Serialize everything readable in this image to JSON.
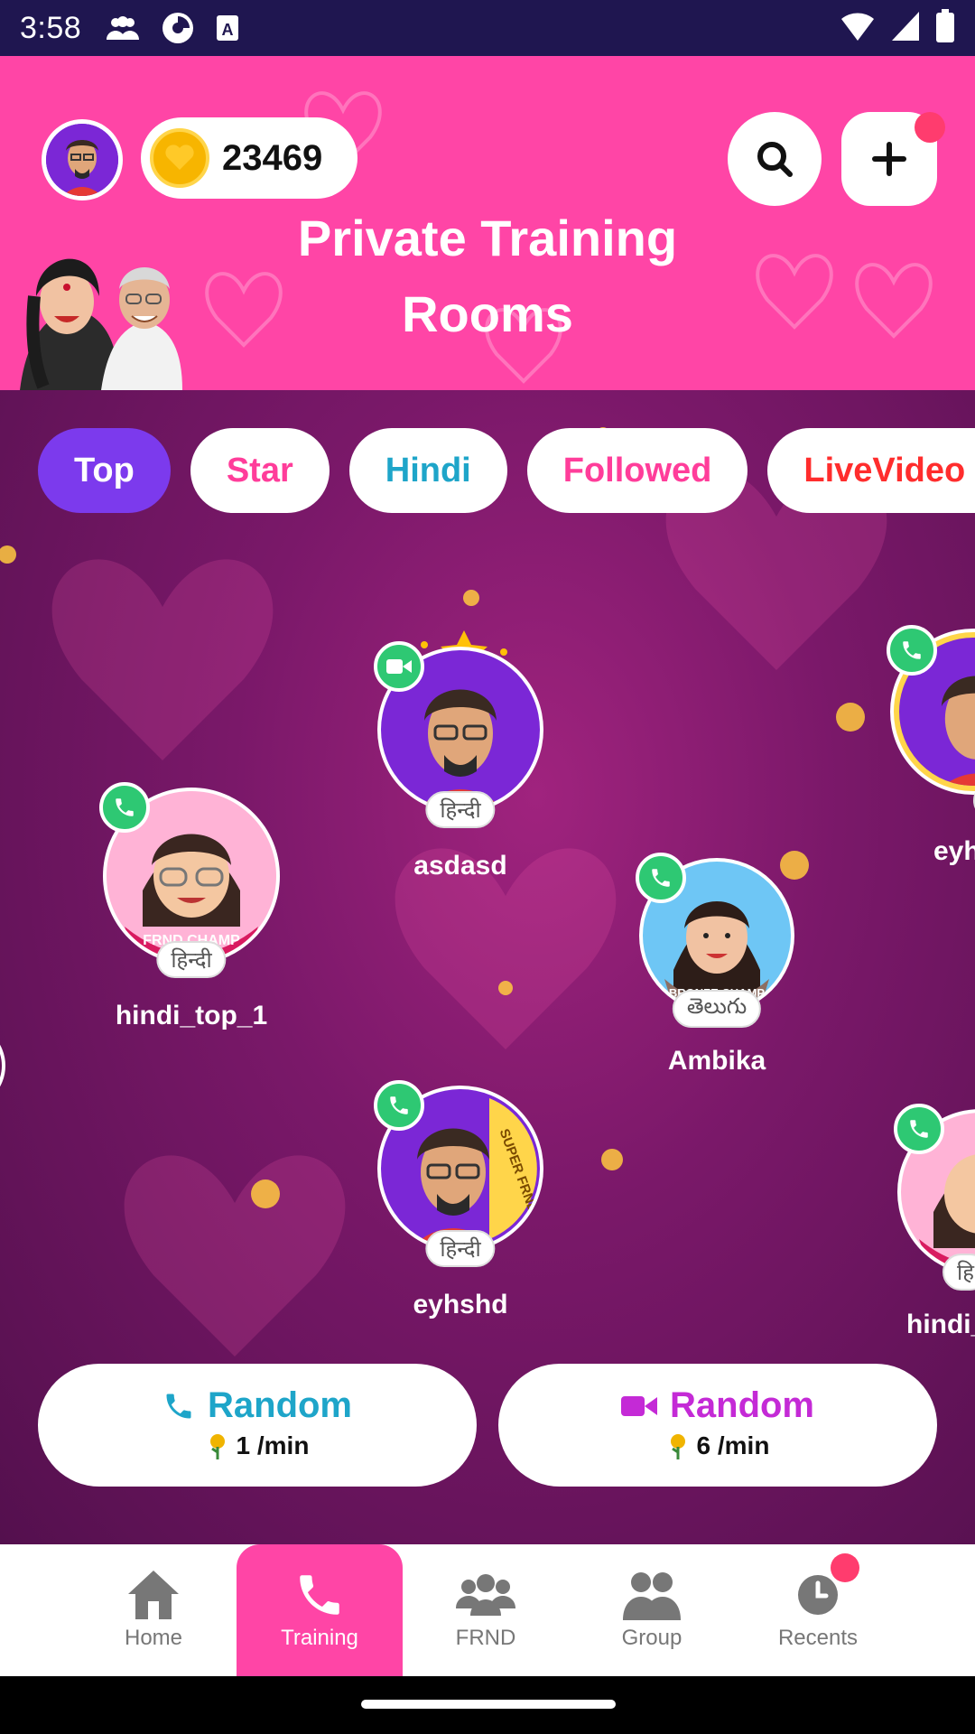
{
  "status_bar": {
    "time": "3:58"
  },
  "header": {
    "coins": "23469",
    "title_line1": "Private Training",
    "title_line2": "Rooms"
  },
  "tabs": [
    {
      "label": "Top",
      "color": "#ffffff",
      "active": true
    },
    {
      "label": "Star",
      "color": "#ff3d9a"
    },
    {
      "label": "Hindi",
      "color": "#1ea5c9"
    },
    {
      "label": "Followed",
      "color": "#ff3d9a"
    },
    {
      "label": "LiveVideo",
      "color": "#ff2d2d"
    }
  ],
  "users": [
    {
      "name": "asdasd",
      "language": "हिन्दी",
      "call": "video"
    },
    {
      "name": "eyh",
      "language": "हि",
      "call": "voice"
    },
    {
      "name": "hindi_top_1",
      "language": "हिन्दी",
      "call": "voice",
      "badge_text": "FRND CHAMP"
    },
    {
      "name": "Ambika",
      "language": "తెలుగు",
      "call": "voice",
      "badge_text": "BRONZE CHAMP"
    },
    {
      "name": "eyhshd",
      "language": "हिन्दी",
      "call": "voice",
      "badge_text": "SUPER FRND"
    },
    {
      "name": "hindi_",
      "language": "हि",
      "call": "voice"
    }
  ],
  "random": {
    "voice": {
      "label": "Random",
      "rate": "1 /min",
      "color": "#1ea5c9"
    },
    "video": {
      "label": "Random",
      "rate": "6 /min",
      "color": "#c42ad6"
    }
  },
  "nav": [
    {
      "label": "Home"
    },
    {
      "label": "Training",
      "active": true
    },
    {
      "label": "FRND"
    },
    {
      "label": "Group"
    },
    {
      "label": "Recents"
    }
  ]
}
